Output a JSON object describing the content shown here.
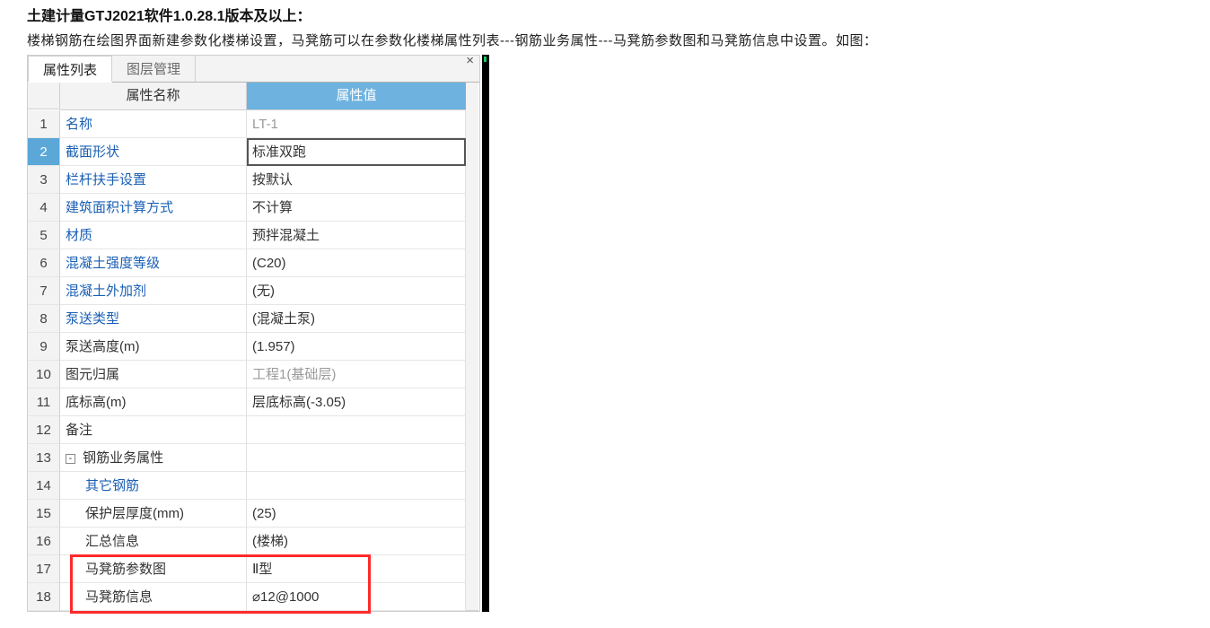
{
  "title": "土建计量GTJ2021软件1.0.28.1版本及以上：",
  "description": "楼梯钢筋在绘图界面新建参数化楼梯设置，马凳筋可以在参数化楼梯属性列表---钢筋业务属性---马凳筋参数图和马凳筋信息中设置。如图：",
  "tabs": {
    "properties": "属性列表",
    "layers": "图层管理"
  },
  "columns": {
    "name": "属性名称",
    "value": "属性值"
  },
  "close": "×",
  "toggle_minus": "-",
  "rows": [
    {
      "n": "1",
      "name": "名称",
      "value": "LT-1",
      "link": true,
      "grayVal": true
    },
    {
      "n": "2",
      "name": "截面形状",
      "value": "标准双跑",
      "link": true,
      "editing": true,
      "selNum": true
    },
    {
      "n": "3",
      "name": "栏杆扶手设置",
      "value": "按默认",
      "link": true
    },
    {
      "n": "4",
      "name": "建筑面积计算方式",
      "value": "不计算",
      "link": true
    },
    {
      "n": "5",
      "name": "材质",
      "value": "预拌混凝土",
      "link": true
    },
    {
      "n": "6",
      "name": "混凝土强度等级",
      "value": "(C20)",
      "link": true
    },
    {
      "n": "7",
      "name": "混凝土外加剂",
      "value": "(无)",
      "link": true
    },
    {
      "n": "8",
      "name": "泵送类型",
      "value": "(混凝土泵)",
      "link": true
    },
    {
      "n": "9",
      "name": "泵送高度(m)",
      "value": "(1.957)"
    },
    {
      "n": "10",
      "name": "图元归属",
      "value": "工程1(基础层)",
      "grayVal": true
    },
    {
      "n": "11",
      "name": "底标高(m)",
      "value": "层底标高(-3.05)"
    },
    {
      "n": "12",
      "name": "备注",
      "value": ""
    },
    {
      "n": "13",
      "name": "钢筋业务属性",
      "value": "",
      "group": true
    },
    {
      "n": "14",
      "name": "其它钢筋",
      "value": "",
      "child": true,
      "link": true
    },
    {
      "n": "15",
      "name": "保护层厚度(mm)",
      "value": "(25)",
      "child": true
    },
    {
      "n": "16",
      "name": "汇总信息",
      "value": "(楼梯)",
      "child": true
    },
    {
      "n": "17",
      "name": "马凳筋参数图",
      "value": "Ⅱ型",
      "child": true,
      "hl": true
    },
    {
      "n": "18",
      "name": "马凳筋信息",
      "value": "⌀12@1000",
      "child": true,
      "hl": true
    }
  ]
}
